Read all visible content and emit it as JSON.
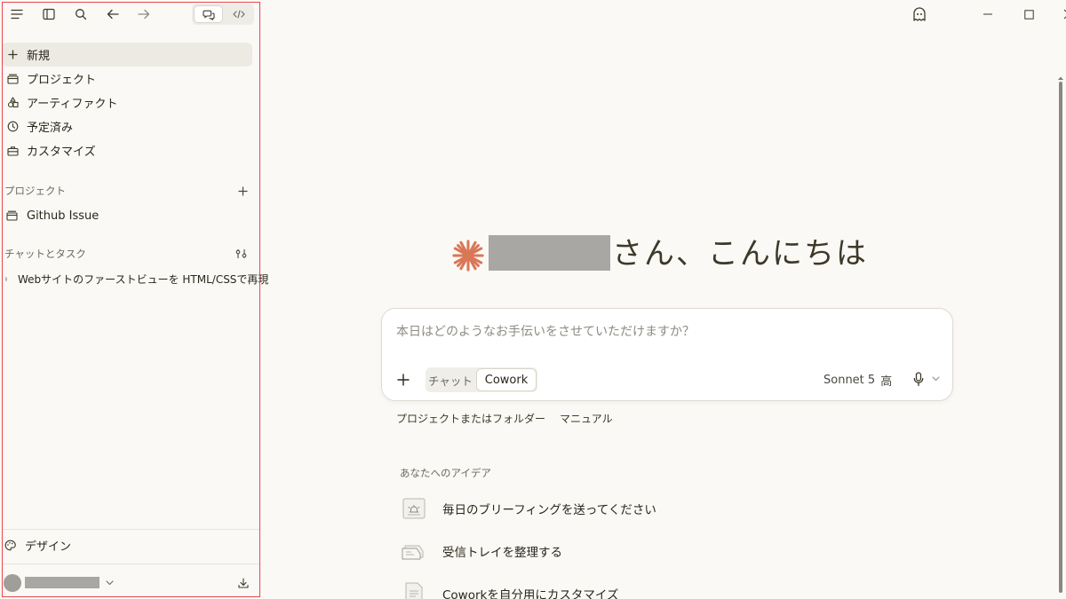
{
  "sidebar": {
    "nav": [
      {
        "label": "新規",
        "icon": "plus-icon"
      },
      {
        "label": "プロジェクト",
        "icon": "folder-icon"
      },
      {
        "label": "アーティファクト",
        "icon": "artifacts-icon"
      },
      {
        "label": "予定済み",
        "icon": "clock-icon"
      },
      {
        "label": "カスタマイズ",
        "icon": "briefcase-icon"
      }
    ],
    "projects_heading": "プロジェクト",
    "projects": [
      {
        "label": "Github Issue"
      }
    ],
    "chats_heading": "チャットとタスク",
    "chats": [
      {
        "label": "Webサイトのファーストビューを HTML/CSSで再現"
      }
    ],
    "design_label": "デザイン"
  },
  "main": {
    "greeting": "さん、こんにちは",
    "composer": {
      "placeholder": "本日はどのようなお手伝いをさせていただけますか？",
      "mode_chat": "チャット",
      "mode_cowork": "Cowork",
      "model": "Sonnet 5",
      "effort": "高"
    },
    "below_composer": {
      "project_folder": "プロジェクトまたはフォルダー",
      "manual": "マニュアル"
    },
    "ideas_heading": "あなたへのアイデア",
    "ideas": [
      {
        "label": "毎日のブリーフィングを送ってください",
        "icon": "bell-icon"
      },
      {
        "label": "受信トレイを整理する",
        "icon": "inbox-icon"
      },
      {
        "label": "Coworkを自分用にカスタマイズ",
        "icon": "document-icon"
      }
    ]
  },
  "colors": {
    "accent": "#d97757",
    "sidebar_outline": "#e8474f",
    "background": "#faf9f5"
  }
}
